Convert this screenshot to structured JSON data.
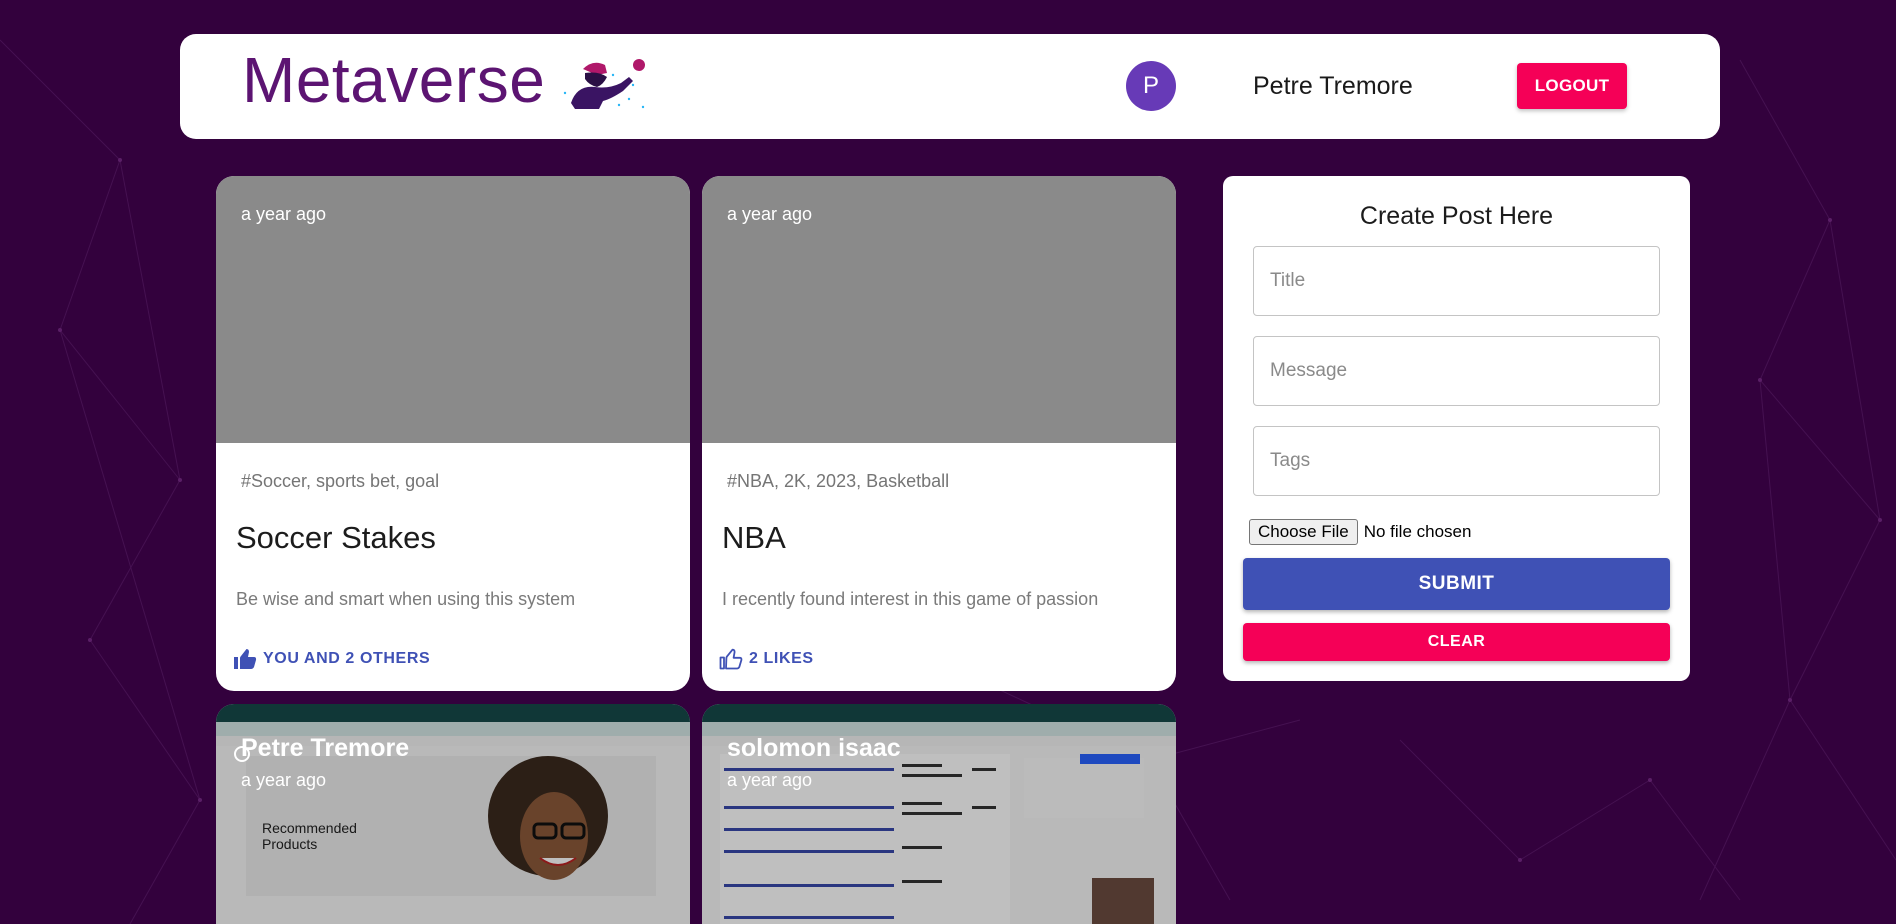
{
  "header": {
    "brand_title": "Metaverse",
    "avatar_initial": "P",
    "user_name": "Petre Tremore",
    "logout_label": "LOGOUT"
  },
  "posts": [
    {
      "time": "a year ago",
      "tags": "#Soccer, sports bet, goal",
      "title": "Soccer Stakes",
      "message": "Be wise and smart when using this system",
      "like_label": "YOU AND 2 OTHERS"
    },
    {
      "time": "a year ago",
      "tags": "#NBA, 2K, 2023, Basketball",
      "title": "NBA",
      "message": "I recently found interest in this game of passion",
      "like_label": "2 LIKES"
    },
    {
      "author": "Petre Tremore",
      "time": "a year ago",
      "image_text": "Recommended Products"
    },
    {
      "author": "solomon isaac",
      "time": "a year ago"
    }
  ],
  "form": {
    "heading": "Create Post Here",
    "title_placeholder": "Title",
    "message_placeholder": "Message",
    "tags_placeholder": "Tags",
    "file_button": "Choose File",
    "file_status": "No file chosen",
    "submit_label": "SUBMIT",
    "clear_label": "CLEAR"
  },
  "colors": {
    "background": "#33013d",
    "brand": "#5c1472",
    "primary": "#3f51b5",
    "secondary": "#f50057",
    "avatar": "#673ab7"
  }
}
